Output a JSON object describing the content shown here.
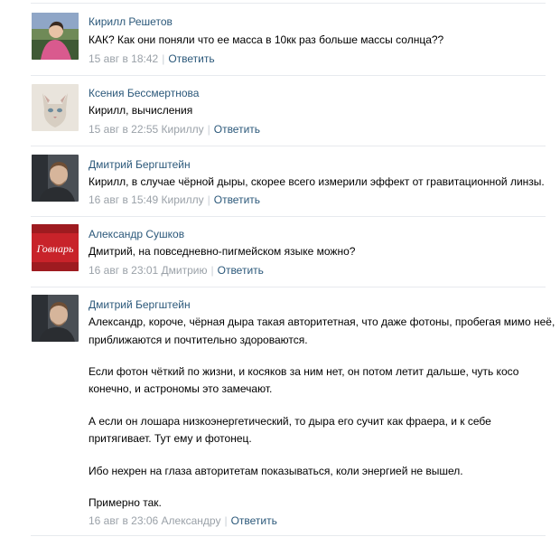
{
  "comments": [
    {
      "author": "Кирилл Решетов",
      "lines": [
        "КАК? Как они поняли что ее масса в 10кк раз больше массы солнца??"
      ],
      "date": "15 авг в 18:42",
      "reply_to": "",
      "reply_label": "Ответить",
      "avatar_icon": "user-photo-woman"
    },
    {
      "author": "Ксения Бессмертнова",
      "lines": [
        "Кирилл, вычисления"
      ],
      "date": "15 авг в 22:55",
      "reply_to": "Кириллу",
      "reply_label": "Ответить",
      "avatar_icon": "cat-photo"
    },
    {
      "author": "Дмитрий Бергштейн",
      "lines": [
        "Кирилл, в случае чёрной дыры, скорее всего измерили эффект от гравитационной линзы."
      ],
      "date": "16 авг в 15:49",
      "reply_to": "Кириллу",
      "reply_label": "Ответить",
      "avatar_icon": "man-photo"
    },
    {
      "author": "Александр Сушков",
      "lines": [
        "Дмитрий, на повседневно-пигмейском языке можно?"
      ],
      "date": "16 авг в 23:01",
      "reply_to": "Дмитрию",
      "reply_label": "Ответить",
      "avatar_icon": "brand-logo",
      "avatar_logo_text": "Говнарь"
    },
    {
      "author": "Дмитрий Бергштейн",
      "lines": [
        "Александр, короче, чёрная дыра такая авторитетная, что даже фотоны, пробегая мимо неё,",
        "приближаются и почтительно здороваются.",
        "Если фотон чёткий по жизни, и косяков за ним нет, он потом летит дальше, чуть косо",
        "конечно, и астрономы это замечают.",
        "А если он лошара низкоэнергетический, то дыра его сучит как фраера, и к себе",
        "притягивает. Тут ему и фотонец.",
        "Ибо нехрен на глаза авторитетам показываться, коли энергией не вышел.",
        "Примерно так."
      ],
      "date": "16 авг в 23:06",
      "reply_to": "Александру",
      "reply_label": "Ответить",
      "avatar_icon": "man-photo"
    }
  ],
  "colors": {
    "link": "#2b587a",
    "meta": "#9aa1a8",
    "divider": "#e7eaee",
    "logo_bg": "#c8232a"
  }
}
